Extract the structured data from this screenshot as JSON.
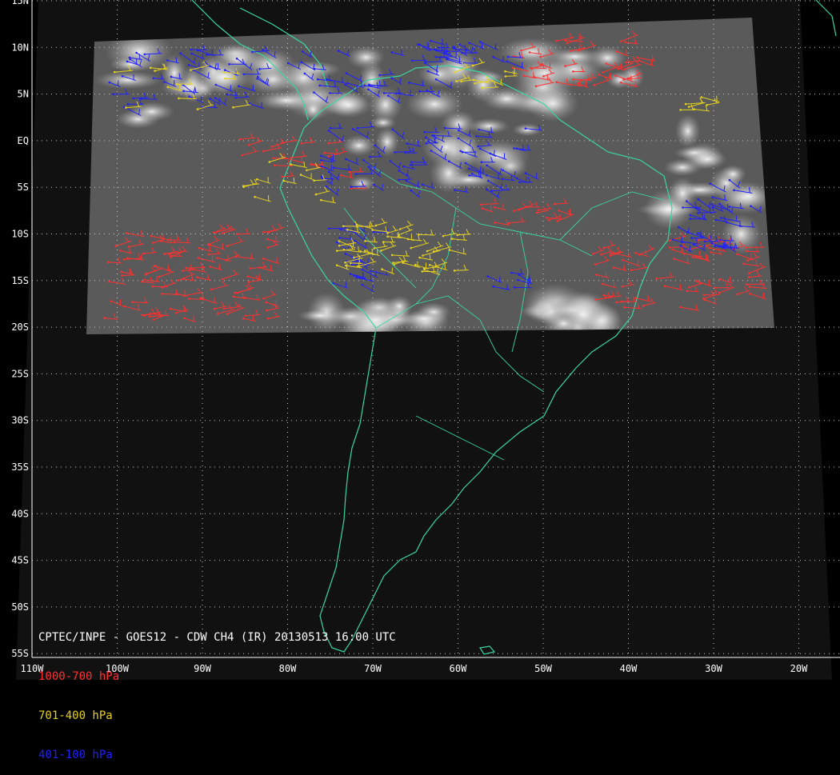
{
  "latitude_labels": [
    "15N",
    "10N",
    "5N",
    "EQ",
    "5S",
    "10S",
    "15S",
    "20S",
    "25S",
    "30S",
    "35S",
    "40S",
    "45S",
    "50S",
    "55S"
  ],
  "longitude_labels": [
    "110W",
    "100W",
    "90W",
    "80W",
    "70W",
    "60W",
    "50W",
    "40W",
    "30W",
    "20W"
  ],
  "header": {
    "title": "CPTEC/INPE - GOES12 - CDW CH4 (IR) 20130513 16:00 UTC"
  },
  "legend": {
    "items": [
      {
        "label": "1000-700 hPa",
        "color": "#ff3030"
      },
      {
        "label": "701-400 hPa",
        "color": "#e6d21e"
      },
      {
        "label": "401-100 hPa",
        "color": "#2020ff"
      }
    ]
  },
  "colors": {
    "background": "#000000",
    "coastline": "#3ad6a0",
    "grid": "#c8c8c8",
    "text": "#ffffff",
    "low_level_vectors": "#ff3030",
    "mid_level_vectors": "#e6d21e",
    "high_level_vectors": "#2020ff"
  }
}
